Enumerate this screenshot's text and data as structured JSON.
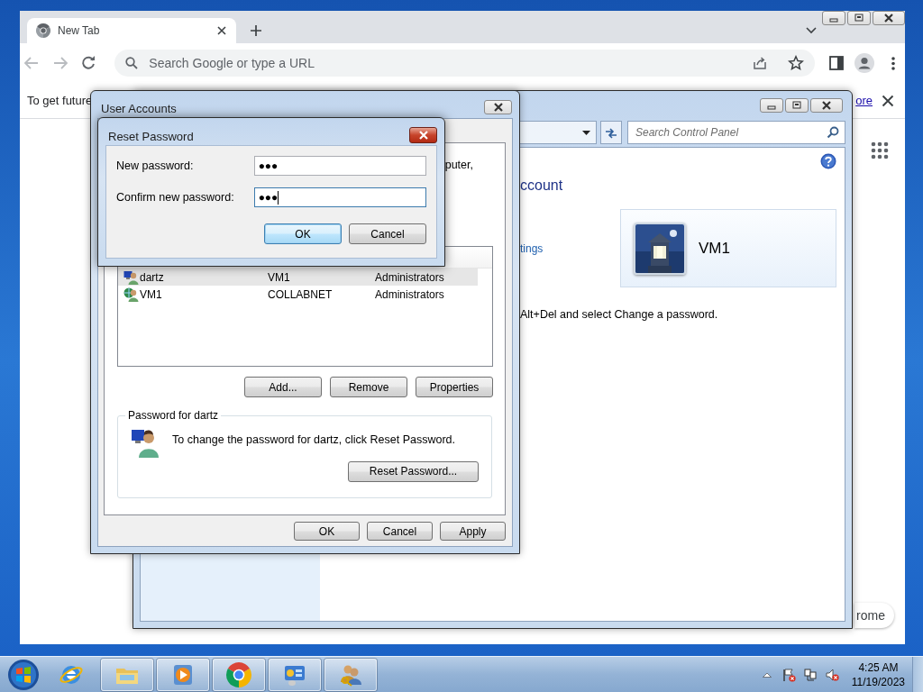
{
  "browser": {
    "tab": {
      "title": "New Tab",
      "selected": true
    },
    "back": {
      "disabled": true
    },
    "forward": {
      "disabled": true
    },
    "omnibox": {
      "placeholder": "Search Google or type a URL"
    },
    "infobar": {
      "text": "To get future",
      "link": "ore"
    },
    "customize_button": "rome"
  },
  "control_panel": {
    "search": {
      "placeholder": "Search Control Panel"
    },
    "heading": "ccount",
    "link": "tings",
    "account": {
      "name": "VM1"
    },
    "note": "Alt+Del and select Change a password."
  },
  "user_accounts": {
    "title": "User Accounts",
    "intro": "puter,",
    "users": [
      {
        "kind": "local",
        "name": "dartz",
        "domain": "VM1",
        "group": "Administrators",
        "selected": true
      },
      {
        "kind": "domain",
        "name": "VM1",
        "domain": "COLLABNET",
        "group": "Administrators",
        "selected": false
      }
    ],
    "list_buttons": [
      "Add...",
      "Remove",
      "Properties"
    ],
    "password_group": {
      "title": "Password for dartz",
      "text": "To change the password for dartz, click Reset Password.",
      "button": "Reset Password..."
    },
    "buttons": [
      "OK",
      "Cancel",
      "Apply"
    ]
  },
  "reset_password": {
    "title": "Reset Password",
    "fields": [
      {
        "label": "New password:",
        "value": "●●●",
        "focused": false
      },
      {
        "label": "Confirm new password:",
        "value": "●●●",
        "focused": true
      }
    ],
    "buttons": [
      {
        "label": "OK",
        "default": true
      },
      {
        "label": "Cancel",
        "default": false
      }
    ]
  },
  "taskbar": {
    "apps": [
      {
        "kind": "ie",
        "running": false
      },
      {
        "kind": "explorer",
        "running": true
      },
      {
        "kind": "media",
        "running": true
      },
      {
        "kind": "chrome",
        "running": true
      },
      {
        "kind": "control-panel",
        "running": true
      },
      {
        "kind": "users",
        "running": true
      }
    ],
    "clock": {
      "time": "4:25 AM",
      "date": "11/19/2023"
    }
  }
}
